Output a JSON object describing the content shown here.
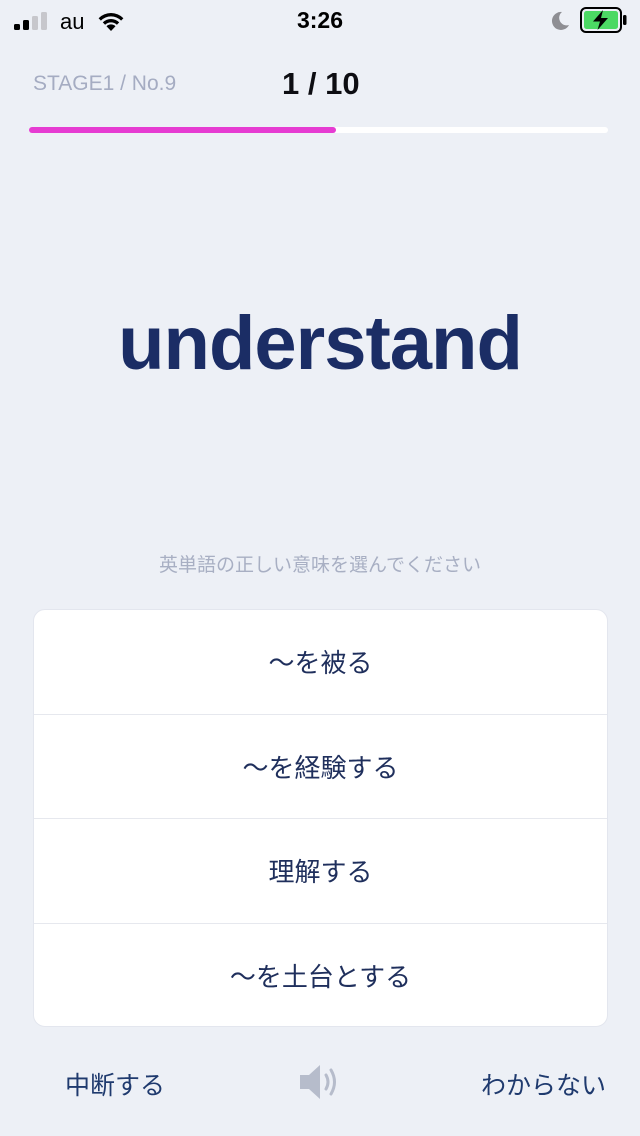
{
  "status_bar": {
    "carrier": "au",
    "time": "3:26",
    "battery_charging": true,
    "colors": {
      "battery_fill": "#4cd964",
      "signal_active": "#000000",
      "signal_inactive": "#c7c7cc"
    }
  },
  "header": {
    "stage_label": "STAGE1 / No.9",
    "counter": "1 / 10",
    "progress_fraction": 0.53,
    "progress_color": "#e63cd2"
  },
  "question": {
    "word": "understand",
    "instruction": "英単語の正しい意味を選んでください"
  },
  "choices": [
    {
      "label": "〜を被る"
    },
    {
      "label": "〜を経験する"
    },
    {
      "label": "理解する"
    },
    {
      "label": "〜を土台とする"
    }
  ],
  "footer": {
    "quit_label": "中断する",
    "speaker_icon": "speaker-icon",
    "dont_know_label": "わからない"
  },
  "theme": {
    "background": "#edf0f6",
    "accent": "#e63cd2",
    "text_primary": "#1b2d65"
  }
}
